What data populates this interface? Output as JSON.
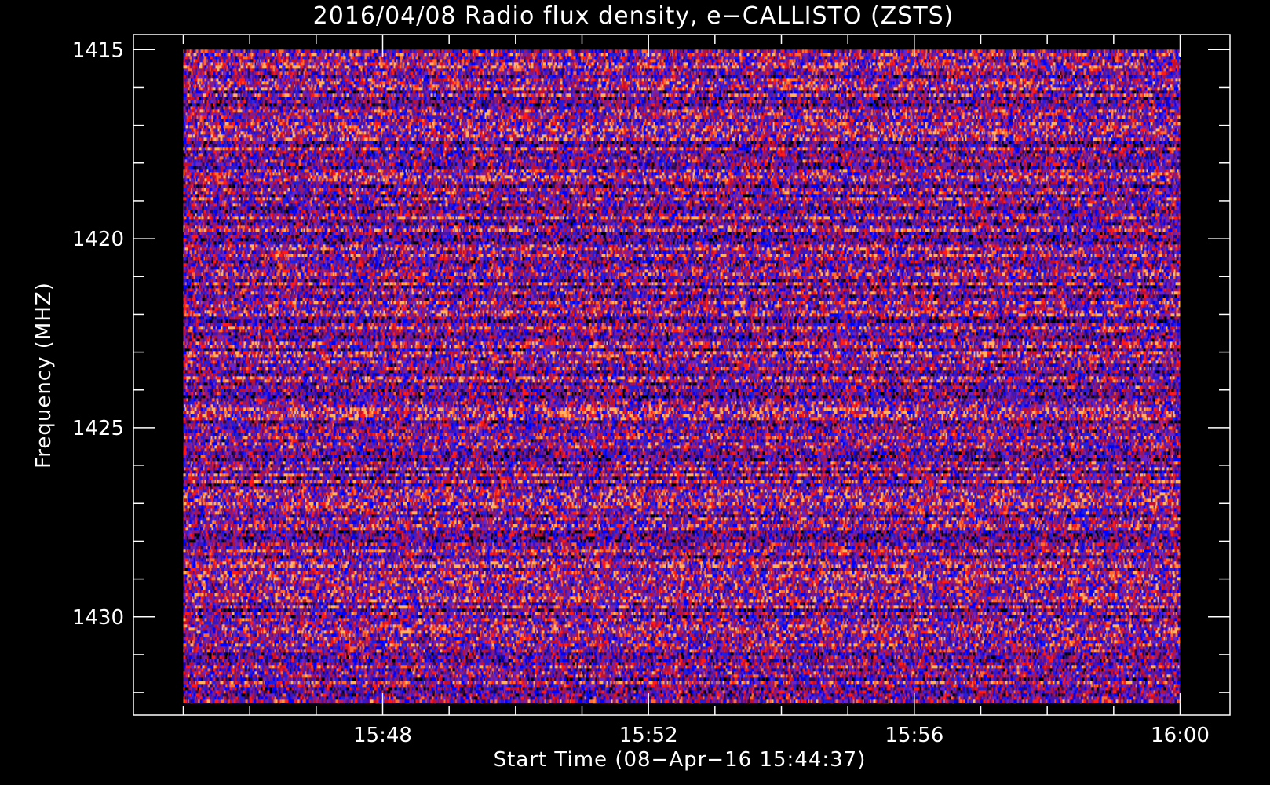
{
  "chart_data": {
    "type": "heatmap",
    "title": "2016/04/08  Radio flux density, e−CALLISTO (ZSTS)",
    "xlabel": "Start Time (08−Apr−16 15:44:37)",
    "ylabel": "Frequency (MHZ)",
    "x_ticks": [
      "15:48",
      "15:52",
      "15:56",
      "16:00"
    ],
    "y_ticks": [
      1415,
      1420,
      1425,
      1430
    ],
    "x_range": [
      "15:45:00",
      "16:00:00"
    ],
    "xlim": [
      "15:44:15",
      "16:00:45"
    ],
    "ylim": [
      1414.6,
      1432.6
    ],
    "data_freq_range": [
      1415.0,
      1432.3
    ],
    "grid": false,
    "colormap": [
      "#000000",
      "#2a0a4a",
      "#4a14a8",
      "#1f1fe0",
      "#0000ff",
      "#6a24c8",
      "#8a1a7a",
      "#c01030",
      "#ff1a1a",
      "#ff6a30",
      "#ffb060"
    ],
    "colors": {
      "background": "#000000",
      "axes": "#ffffff",
      "text": "#ffffff"
    }
  }
}
